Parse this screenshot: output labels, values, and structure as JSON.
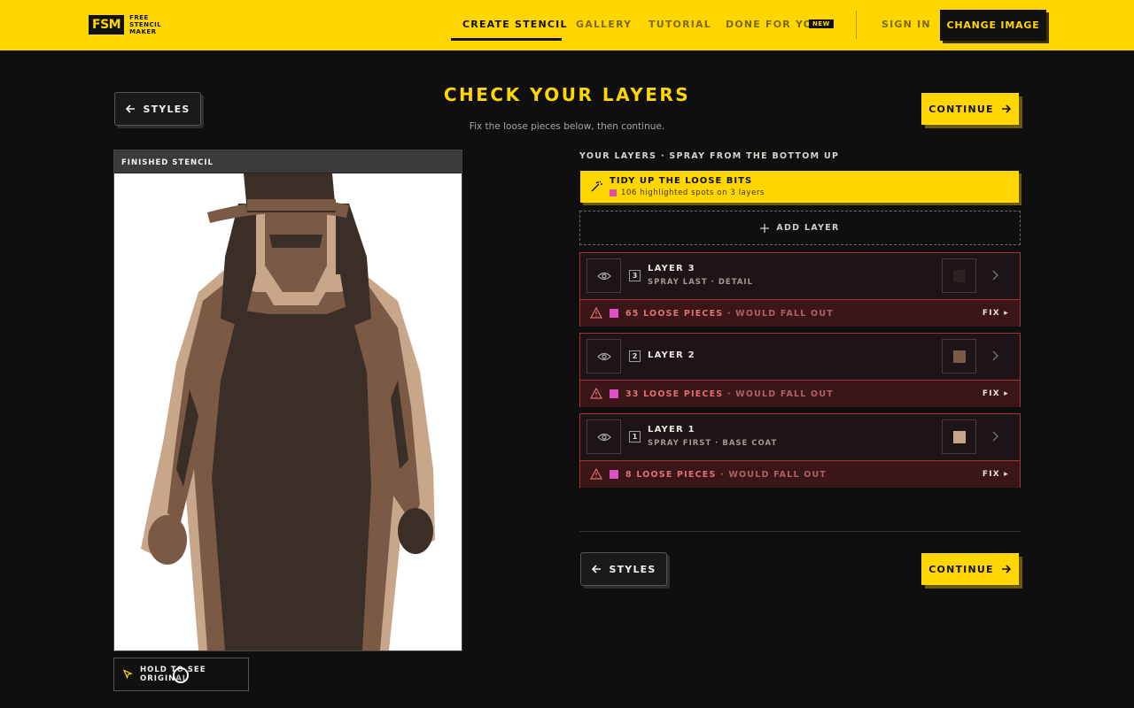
{
  "header": {
    "logo_mark": "FSM",
    "logo_lines": [
      "FREE",
      "STENCIL",
      "MAKER"
    ],
    "nav": [
      {
        "label": "CREATE STENCIL",
        "active": true
      },
      {
        "label": "GALLERY",
        "active": false
      },
      {
        "label": "TUTORIAL",
        "active": false
      },
      {
        "label": "DONE FOR YOU",
        "active": false
      }
    ],
    "new_badge": "NEW",
    "sign_in": "SIGN IN",
    "change_image": "CHANGE IMAGE"
  },
  "page": {
    "title": "CHECK YOUR LAYERS",
    "subtitle": "Fix the loose pieces below, then continue.",
    "back_label": "STYLES",
    "continue_label": "CONTINUE"
  },
  "preview": {
    "label": "FINISHED STENCIL",
    "hold_label": "HOLD TO SEE ORIGINAL"
  },
  "layers": {
    "heading": "YOUR LAYERS · SPRAY FROM THE BOTTOM UP",
    "tidy_title": "TIDY UP THE LOOSE BITS",
    "tidy_sub": "106 highlighted spots on 3 layers",
    "add_layer": "ADD LAYER",
    "fix_label": "FIX ▸",
    "items": [
      {
        "num": "3",
        "name": "LAYER 3",
        "sub": "SPRAY LAST · DETAIL",
        "swatch": "#2a2220",
        "warn_count": "65 LOOSE PIECES",
        "warn_tail": "· WOULD FALL OUT"
      },
      {
        "num": "2",
        "name": "LAYER 2",
        "sub": "",
        "swatch": "#7a5a44",
        "warn_count": "33 LOOSE PIECES",
        "warn_tail": "· WOULD FALL OUT"
      },
      {
        "num": "1",
        "name": "LAYER 1",
        "sub": "SPRAY FIRST · BASE COAT",
        "swatch": "#c8a68a",
        "warn_count": "8 LOOSE PIECES",
        "warn_tail": "· WOULD FALL OUT"
      }
    ]
  },
  "colors": {
    "accent": "#ffd600",
    "warning_border": "#a33434",
    "loose_marker": "#e04fc8",
    "stencil_dark": "#3b2e27",
    "stencil_mid": "#7a5a44",
    "stencil_light": "#c8a68a"
  }
}
